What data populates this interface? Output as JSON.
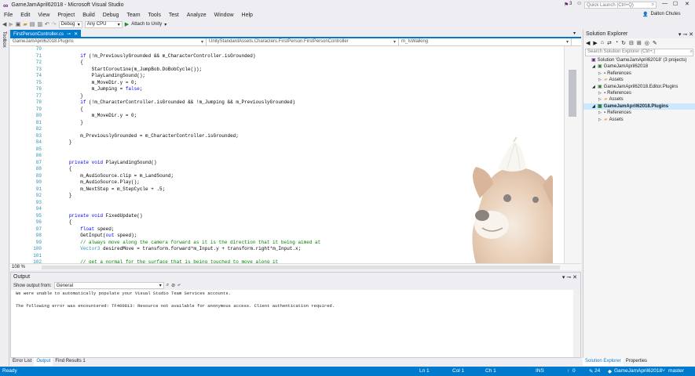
{
  "window": {
    "title": "GameJamApril62018 - Microsoft Visual Studio",
    "quick_launch": "Quick Launch (Ctrl+Q)",
    "user": "Dalton Chutes",
    "notification_count": "3"
  },
  "menu": [
    "File",
    "Edit",
    "View",
    "Project",
    "Build",
    "Debug",
    "Team",
    "Tools",
    "Test",
    "Analyze",
    "Window",
    "Help"
  ],
  "toolbar": {
    "config": "Debug",
    "platform": "Any CPU",
    "attach": "Attach to Unity"
  },
  "left_tab": "Toolbox",
  "editor": {
    "tab": "FirstPersonController.cs",
    "nav": [
      "GameJamApril62018.Plugins",
      "UnityStandardAssets.Characters.FirstPerson.FirstPersonController",
      "m_IsWalking"
    ],
    "zoom": "108 %",
    "line_numbers": [
      70,
      71,
      72,
      73,
      74,
      75,
      76,
      77,
      78,
      79,
      80,
      81,
      82,
      83,
      84,
      85,
      86,
      87,
      88,
      89,
      90,
      91,
      92,
      93,
      94,
      95,
      96,
      97,
      98,
      99,
      100,
      101,
      102,
      103
    ],
    "lines": [
      "",
      "            if (!m_PreviouslyGrounded && m_CharacterController.isGrounded)",
      "            {",
      "                StartCoroutine(m_JumpBob.DoBobCycle());",
      "                PlayLandingSound();",
      "                m_MoveDir.y = 0f;",
      "                m_Jumping = false;",
      "            }",
      "            if (!m_CharacterController.isGrounded && !m_Jumping && m_PreviouslyGrounded)",
      "            {",
      "                m_MoveDir.y = 0f;",
      "            }",
      "",
      "            m_PreviouslyGrounded = m_CharacterController.isGrounded;",
      "        }",
      "",
      "",
      "        private void PlayLandingSound()",
      "        {",
      "            m_AudioSource.clip = m_LandSound;",
      "            m_AudioSource.Play();",
      "            m_NextStep = m_StepCycle + .5f;",
      "        }",
      "",
      "",
      "        private void FixedUpdate()",
      "        {",
      "            float speed;",
      "            GetInput(out speed);",
      "            // always move along the camera forward as it is the direction that it being aimed at",
      "            Vector3 desiredMove = transform.forward*m_Input.y + transform.right*m_Input.x;",
      "",
      "            // get a normal for the surface that is being touched to move along it",
      ""
    ]
  },
  "output": {
    "title": "Output",
    "show_from_label": "Show output from:",
    "show_from_value": "General",
    "lines": [
      "We were unable to automatically populate your Visual Studio Team Services accounts.",
      "",
      "The following error was encountered: TF400813: Resource not available for anonymous access. Client authentication required."
    ]
  },
  "bottom_tabs": [
    "Error List",
    "Output",
    "Find Results 1"
  ],
  "solution_explorer": {
    "title": "Solution Explorer",
    "search_placeholder": "Search Solution Explorer (Ctrl+;)",
    "items": [
      {
        "label": "Solution 'GameJamApril62018' (3 projects)",
        "indent": 0
      },
      {
        "label": "GameJamApril62018",
        "indent": 1
      },
      {
        "label": "References",
        "indent": 2
      },
      {
        "label": "Assets",
        "indent": 2
      },
      {
        "label": "GameJamApril62018.Editor.Plugins",
        "indent": 1
      },
      {
        "label": "References",
        "indent": 2
      },
      {
        "label": "Assets",
        "indent": 2
      },
      {
        "label": "GameJamApril62018.Plugins",
        "indent": 1,
        "selected": true
      },
      {
        "label": "References",
        "indent": 2
      },
      {
        "label": "Assets",
        "indent": 2
      }
    ],
    "tabs": [
      "Solution Explorer",
      "Properties"
    ]
  },
  "status": {
    "ready": "Ready",
    "ln": "Ln 1",
    "col": "Col 1",
    "ch": "Ch 1",
    "ins": "INS",
    "up": "0",
    "pending": "24",
    "repo": "GameJamApril62018",
    "branch": "master"
  },
  "colors": {
    "accent": "#007acc",
    "keyword": "#0000ff",
    "type": "#2b91af",
    "comment": "#008000"
  }
}
